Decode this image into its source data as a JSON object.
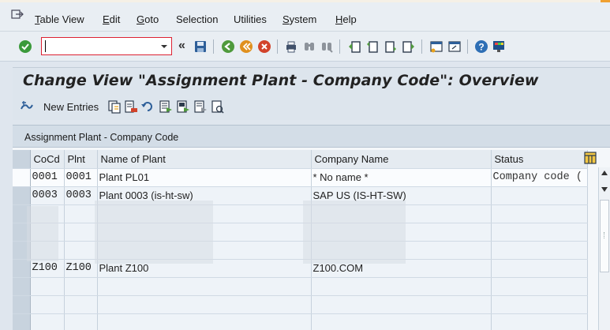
{
  "menu": {
    "items": [
      "Table View",
      "Edit",
      "Goto",
      "Selection",
      "Utilities",
      "System",
      "Help"
    ]
  },
  "toolbar": {
    "command_value": "",
    "icons": [
      "enter-icon",
      "command-dropdown-icon",
      "save-icon",
      "back-icon",
      "exit-icon",
      "cancel-icon",
      "print-icon",
      "find-icon",
      "find-next-icon",
      "first-page-icon",
      "previous-page-icon",
      "next-page-icon",
      "last-page-icon",
      "create-session-icon",
      "shortcut-icon",
      "help-icon",
      "customize-layout-icon"
    ]
  },
  "title": "Change View \"Assignment Plant - Company Code\": Overview",
  "app_toolbar": {
    "new_entries_label": "New Entries",
    "icons": [
      "display-change-icon",
      "copy-as-icon",
      "delete-icon",
      "undo-change-icon",
      "select-all-icon",
      "select-block-icon",
      "deselect-all-icon",
      "other-view-icon"
    ]
  },
  "table": {
    "section_title": "Assignment Plant - Company Code",
    "columns": [
      "CoCd",
      "Plnt",
      "Name of Plant",
      "Company Name",
      "Status"
    ],
    "rows": [
      {
        "cocd": "0001",
        "plnt": "0001",
        "name": "Plant PL01",
        "company": "* No name *",
        "status": "Company code ("
      },
      {
        "cocd": "0003",
        "plnt": "0003",
        "name": "Plant 0003 (is-ht-sw)",
        "company": "SAP US (IS-HT-SW)",
        "status": ""
      },
      {
        "cocd": "",
        "plnt": "",
        "name": "",
        "company": "",
        "status": ""
      },
      {
        "cocd": "",
        "plnt": "",
        "name": "",
        "company": "",
        "status": ""
      },
      {
        "cocd": "",
        "plnt": "",
        "name": "",
        "company": "",
        "status": ""
      },
      {
        "cocd": "Z100",
        "plnt": "Z100",
        "name": "Plant Z100",
        "company": "Z100.COM",
        "status": ""
      },
      {
        "cocd": "",
        "plnt": "",
        "name": "",
        "company": "",
        "status": ""
      },
      {
        "cocd": "",
        "plnt": "",
        "name": "",
        "company": "",
        "status": ""
      },
      {
        "cocd": "",
        "plnt": "",
        "name": "",
        "company": "",
        "status": ""
      }
    ]
  },
  "colors": {
    "accent_red": "#d22b2b",
    "sap_bg": "#dfe6ee",
    "header_bg": "#e5ebf1"
  }
}
